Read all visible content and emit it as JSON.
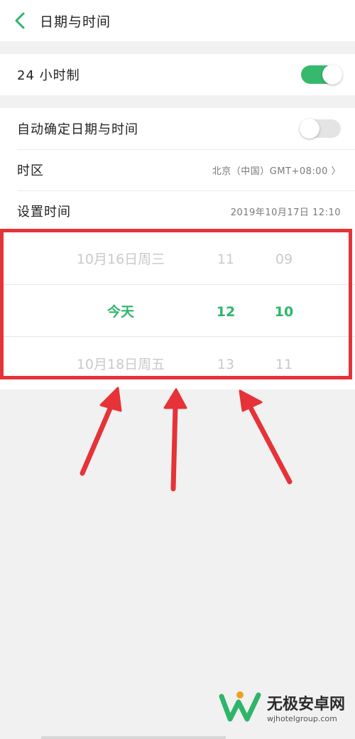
{
  "header": {
    "title": "日期与时间"
  },
  "settings": {
    "hour24": {
      "label": "24 小时制",
      "enabled": true
    },
    "auto_datetime": {
      "label": "自动确定日期与时间",
      "enabled": false
    },
    "timezone": {
      "label": "时区",
      "value": "北京（中国）GMT+08:00 〉"
    },
    "set_time": {
      "label": "设置时间",
      "value": "2019年10月17日  12:10"
    }
  },
  "picker": {
    "prev": {
      "date": "10月16日周三",
      "hour": "11",
      "minute": "09"
    },
    "current": {
      "date": "今天",
      "hour": "12",
      "minute": "10"
    },
    "next": {
      "date": "10月18日周五",
      "hour": "13",
      "minute": "11"
    }
  },
  "watermark": {
    "title": "无极安卓网",
    "url": "wjhotelgroup.com"
  },
  "colors": {
    "accent": "#2fb56a",
    "toggle_on": "#36b96d",
    "annotation": "#e53337"
  }
}
